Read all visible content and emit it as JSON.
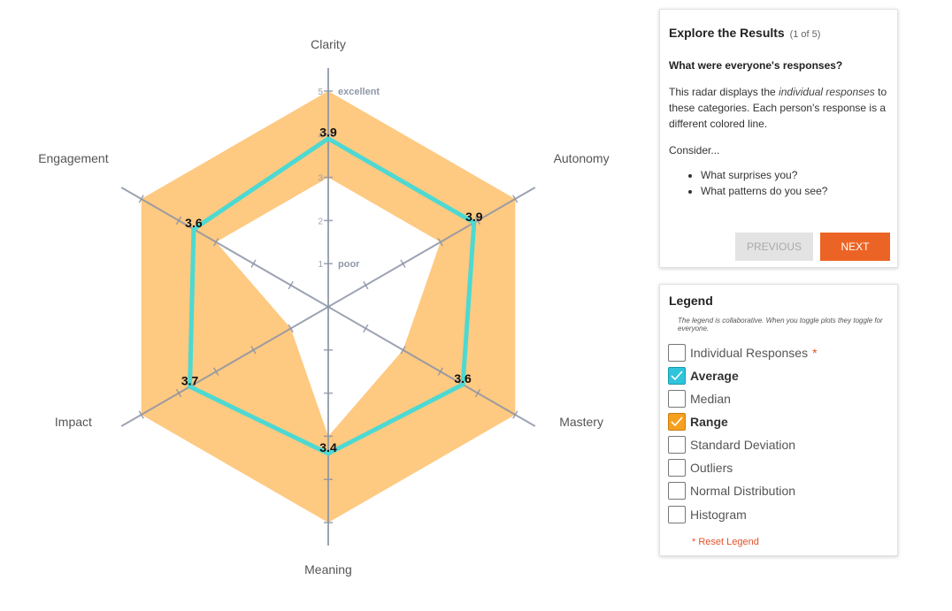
{
  "chart_data": {
    "type": "radar",
    "axes": [
      "Clarity",
      "Autonomy",
      "Mastery",
      "Meaning",
      "Impact",
      "Engagement"
    ],
    "scale": {
      "min": 0,
      "max": 5,
      "ticks": [
        1,
        2,
        3,
        4,
        5
      ]
    },
    "tick_annotations": [
      {
        "value": 5,
        "label": "excellent"
      },
      {
        "value": 1,
        "label": "poor"
      }
    ],
    "series": [
      {
        "name": "Average",
        "color": "#4dd9d2",
        "values": [
          3.9,
          3.9,
          3.6,
          3.4,
          3.7,
          3.6
        ],
        "value_labels": [
          "3.9",
          "3.9",
          "3.6",
          "3.4",
          "3.7",
          "3.6"
        ]
      },
      {
        "name": "Range",
        "color": "#fec981",
        "min": [
          3.0,
          3.0,
          2.0,
          3.0,
          1.0,
          3.0
        ],
        "max": [
          5,
          5,
          5,
          5,
          5,
          5
        ]
      }
    ]
  },
  "explore": {
    "title": "Explore the Results",
    "subtitle": "(1 of 5)",
    "question": "What were everyone's responses?",
    "desc_1": "This radar displays the ",
    "desc_em": "individual responses",
    "desc_2": " to these categories. Each person's response is a different colored line.",
    "consider": "Consider...",
    "bullets": [
      "What surprises you?",
      "What patterns do you see?"
    ],
    "previous_label": "PREVIOUS",
    "next_label": "NEXT"
  },
  "legend": {
    "title": "Legend",
    "note": "The legend is collaborative. When you toggle plots they toggle for everyone.",
    "items": [
      {
        "label": "Individual Responses",
        "checked": false,
        "star": "*"
      },
      {
        "label": "Average",
        "checked": true,
        "color": "#2ec4dc"
      },
      {
        "label": "Median",
        "checked": false
      },
      {
        "label": "Range",
        "checked": true,
        "color": "#f5a01f"
      },
      {
        "label": "Standard Deviation",
        "checked": false
      },
      {
        "label": "Outliers",
        "checked": false
      },
      {
        "label": "Normal Distribution",
        "checked": false
      },
      {
        "label": "Histogram",
        "checked": false
      }
    ],
    "reset_label": "* Reset Legend"
  }
}
